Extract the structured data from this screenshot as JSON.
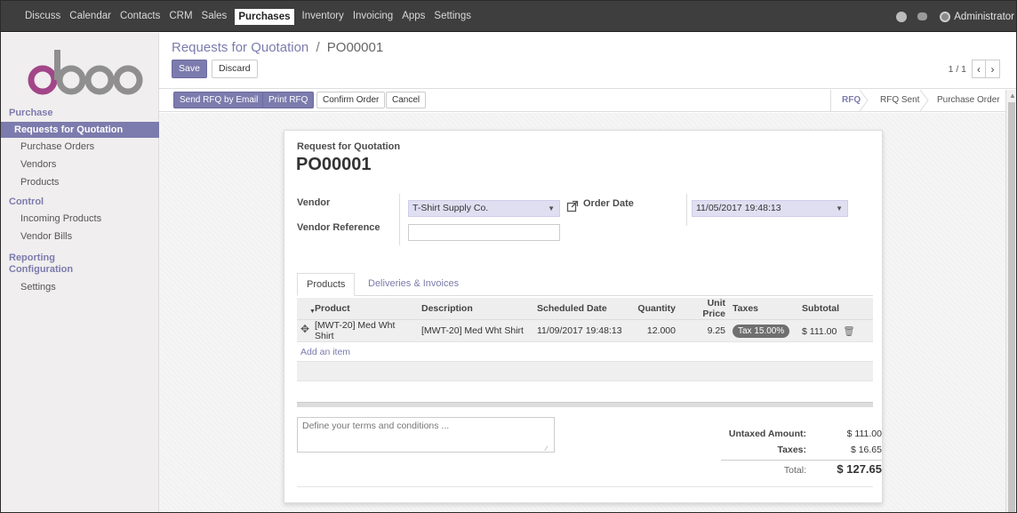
{
  "topbar": {
    "apps": [
      "Discuss",
      "Calendar",
      "Contacts",
      "CRM",
      "Sales",
      "Purchases",
      "Inventory",
      "Invoicing",
      "Apps",
      "Settings"
    ],
    "active_app": "Purchases",
    "user": "Administrator"
  },
  "sidebar": {
    "sections": [
      {
        "title": "Purchase",
        "items": [
          "Requests for Quotation",
          "Purchase Orders",
          "Vendors",
          "Products"
        ]
      },
      {
        "title": "Control",
        "items": [
          "Incoming Products",
          "Vendor Bills"
        ]
      },
      {
        "title": "Reporting",
        "items": []
      },
      {
        "title": "Configuration",
        "items": [
          "Settings"
        ]
      }
    ],
    "active_item": "Requests for Quotation"
  },
  "control": {
    "breadcrumb_parent": "Requests for Quotation",
    "breadcrumb_sep": "/",
    "breadcrumb_current": "PO00001",
    "save": "Save",
    "discard": "Discard",
    "pager_value": "1 / 1"
  },
  "statusbar": {
    "buttons": [
      "Send RFQ by Email",
      "Print RFQ",
      "Confirm Order",
      "Cancel"
    ],
    "stages": [
      "RFQ",
      "RFQ Sent",
      "Purchase Order"
    ],
    "active_stage": "RFQ"
  },
  "form": {
    "subtitle": "Request for Quotation",
    "name": "PO00001",
    "vendor_label": "Vendor",
    "vendor_value": "T-Shirt Supply Co.",
    "vendor_ref_label": "Vendor Reference",
    "vendor_ref_value": "",
    "order_date_label": "Order Date",
    "order_date_value": "11/05/2017 19:48:13",
    "tabs": [
      "Products",
      "Deliveries & Invoices"
    ],
    "columns": [
      "Product",
      "Description",
      "Scheduled Date",
      "Quantity",
      "Unit Price",
      "Taxes",
      "Subtotal"
    ],
    "lines": [
      {
        "product": "[MWT-20] Med Wht Shirt",
        "description": "[MWT-20] Med Wht Shirt",
        "scheduled_date": "11/09/2017 19:48:13",
        "quantity": "12.000",
        "unit_price": "9.25",
        "taxes": "Tax 15.00%",
        "subtotal": "$ 111.00"
      }
    ],
    "add_item": "Add an item",
    "terms_placeholder": "Define your terms and conditions ...",
    "untaxed_label": "Untaxed Amount:",
    "untaxed_value": "$ 111.00",
    "taxes_label": "Taxes:",
    "taxes_value": "$ 16.65",
    "total_label": "Total:",
    "total_value": "$ 127.65"
  },
  "colors": {
    "brand": "#7c7bad",
    "topbar": "#3e3e3e",
    "sidebar": "#f0eeee"
  }
}
